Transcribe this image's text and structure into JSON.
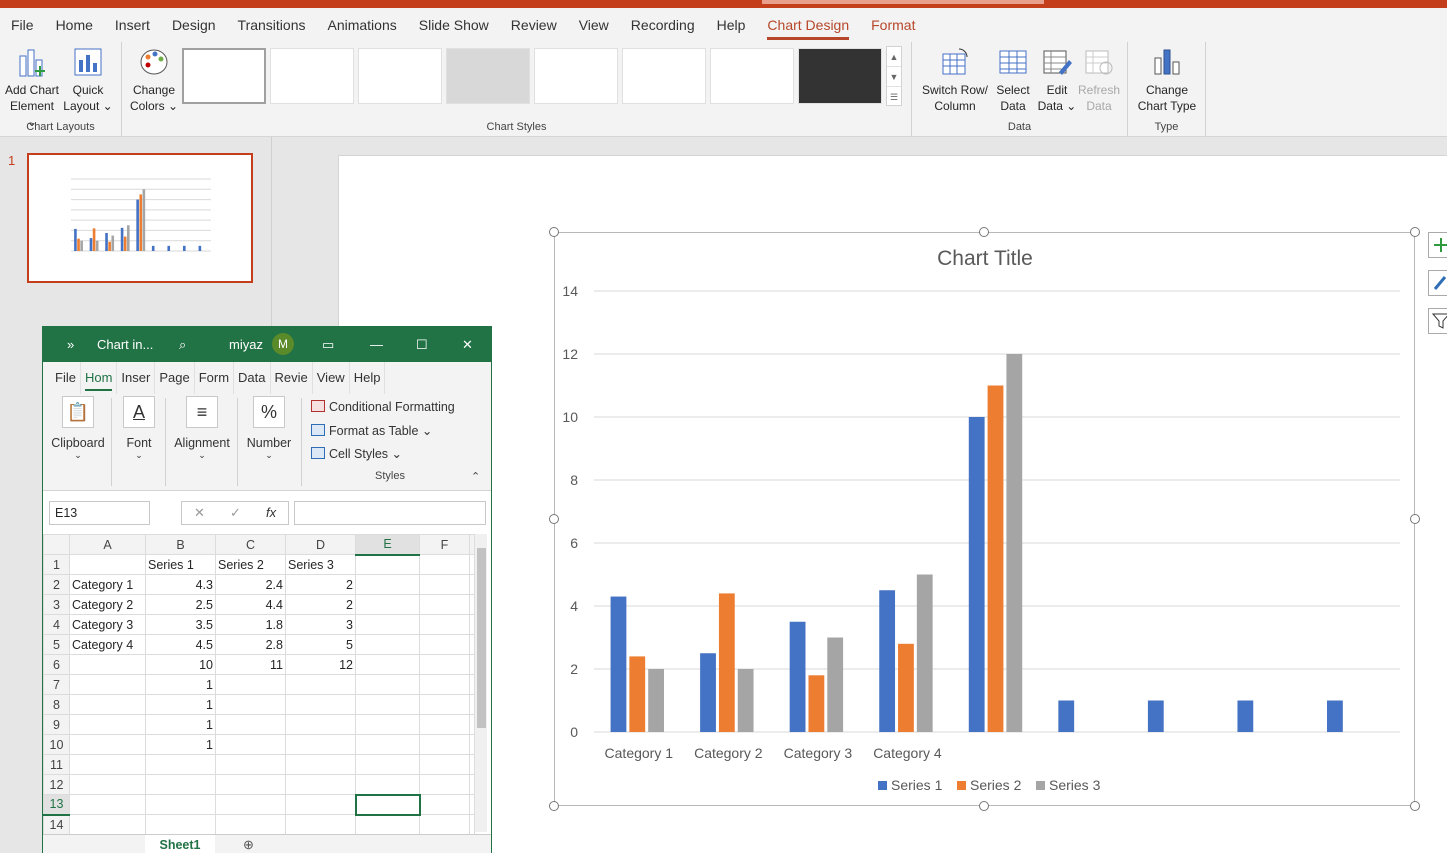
{
  "app": {
    "menu_tabs": [
      "File",
      "Home",
      "Insert",
      "Design",
      "Transitions",
      "Animations",
      "Slide Show",
      "Review",
      "View",
      "Recording",
      "Help",
      "Chart Design",
      "Format"
    ]
  },
  "ribbon": {
    "add_chart_element": [
      "Add Chart",
      "Element ⌄"
    ],
    "quick_layout": [
      "Quick",
      "Layout ⌄"
    ],
    "change_colors": [
      "Change",
      "Colors ⌄"
    ],
    "switch_row_col": [
      "Switch Row/",
      "Column"
    ],
    "select_data": [
      "Select",
      "Data"
    ],
    "edit_data": [
      "Edit",
      "Data ⌄"
    ],
    "refresh_data": [
      "Refresh",
      "Data"
    ],
    "change_chart_type": [
      "Change",
      "Chart Type"
    ],
    "groups": {
      "chart_layouts": "Chart Layouts",
      "chart_styles": "Chart Styles",
      "data": "Data",
      "type": "Type"
    }
  },
  "thumbnail": {
    "slide_number": "1"
  },
  "excel": {
    "title": "Chart in...",
    "user": "miyaz",
    "avatar": "M",
    "menu": [
      "File",
      "Hom",
      "Inser",
      "Page",
      "Form",
      "Data",
      "Revie",
      "View",
      "Help"
    ],
    "ribbon": {
      "clipboard": "Clipboard",
      "font": "Font",
      "alignment": "Alignment",
      "number": "Number",
      "conditional_formatting": "Conditional Formatting",
      "format_as_table": "Format as Table ⌄",
      "cell_styles": "Cell Styles ⌄",
      "styles_group": "Styles"
    },
    "namebox": "E13",
    "fx": "fx",
    "columns": [
      "A",
      "B",
      "C",
      "D",
      "E",
      "F"
    ],
    "rows": [
      [
        "",
        "Series 1",
        "Series 2",
        "Series 3",
        "",
        ""
      ],
      [
        "Category 1",
        "4.3",
        "2.4",
        "2",
        "",
        ""
      ],
      [
        "Category 2",
        "2.5",
        "4.4",
        "2",
        "",
        ""
      ],
      [
        "Category 3",
        "3.5",
        "1.8",
        "3",
        "",
        ""
      ],
      [
        "Category 4",
        "4.5",
        "2.8",
        "5",
        "",
        ""
      ],
      [
        "",
        "10",
        "11",
        "12",
        "",
        ""
      ],
      [
        "",
        "1",
        "",
        "",
        "",
        ""
      ],
      [
        "",
        "1",
        "",
        "",
        "",
        ""
      ],
      [
        "",
        "1",
        "",
        "",
        "",
        ""
      ],
      [
        "",
        "1",
        "",
        "",
        "",
        ""
      ],
      [
        "",
        "",
        "",
        "",
        "",
        ""
      ],
      [
        "",
        "",
        "",
        "",
        "",
        ""
      ],
      [
        "",
        "",
        "",
        "",
        "",
        ""
      ],
      [
        "",
        "",
        "",
        "",
        "",
        ""
      ]
    ],
    "sheet_tab": "Sheet1"
  },
  "colors": {
    "series1": "#4472c4",
    "series2": "#ed7d31",
    "series3": "#a5a5a5",
    "accent": "#b7472a",
    "excel": "#217346"
  },
  "chart_data": {
    "type": "bar",
    "title": "Chart Title",
    "categories": [
      "Category 1",
      "Category 2",
      "Category 3",
      "Category 4",
      "",
      "",
      "",
      "",
      ""
    ],
    "series": [
      {
        "name": "Series 1",
        "values": [
          4.3,
          2.5,
          3.5,
          4.5,
          10,
          1,
          1,
          1,
          1
        ]
      },
      {
        "name": "Series 2",
        "values": [
          2.4,
          4.4,
          1.8,
          2.8,
          11,
          null,
          null,
          null,
          null
        ]
      },
      {
        "name": "Series 3",
        "values": [
          2,
          2,
          3,
          5,
          12,
          null,
          null,
          null,
          null
        ]
      }
    ],
    "ylim": [
      0,
      14
    ],
    "yticks": [
      0,
      2,
      4,
      6,
      8,
      10,
      12,
      14
    ],
    "grid": true,
    "legend": "bottom"
  }
}
